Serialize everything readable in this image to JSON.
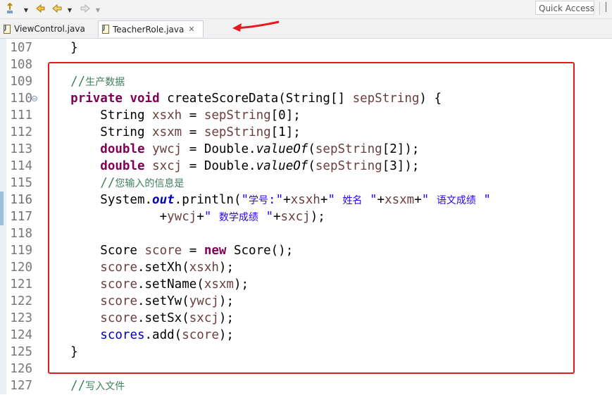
{
  "toolbar": {
    "quick_access_label": "Quick Access"
  },
  "tabs": [
    {
      "label": "ViewControl.java",
      "active": false
    },
    {
      "label": "TeacherRole.java",
      "active": true,
      "close": "✕"
    }
  ],
  "colors": {
    "keyword": "#7f0055",
    "string": "#2a00ff",
    "comment": "#3f7f5f",
    "field": "#0000c0",
    "local_variable": "#6a3e3e",
    "annotation_box": "#e8191e",
    "annotation_arrow": "#e8191e"
  },
  "editor": {
    "lines": [
      {
        "num": "107",
        "tokens": [
          {
            "t": "    }",
            "c": "plain"
          }
        ]
      },
      {
        "num": "108",
        "tokens": []
      },
      {
        "num": "109",
        "tokens": [
          {
            "t": "    //",
            "c": "cmt"
          },
          {
            "t": "生产数据",
            "c": "cmt cn"
          }
        ]
      },
      {
        "num": "110",
        "fold": true,
        "tokens": [
          {
            "t": "    ",
            "c": "plain"
          },
          {
            "t": "private",
            "c": "kw"
          },
          {
            "t": " ",
            "c": "plain"
          },
          {
            "t": "void",
            "c": "kw"
          },
          {
            "t": " createScoreData(String[] ",
            "c": "plain"
          },
          {
            "t": "sepString",
            "c": "var"
          },
          {
            "t": ") {",
            "c": "plain"
          }
        ]
      },
      {
        "num": "111",
        "tokens": [
          {
            "t": "        String ",
            "c": "plain"
          },
          {
            "t": "xsxh",
            "c": "var"
          },
          {
            "t": " = ",
            "c": "plain"
          },
          {
            "t": "sepString",
            "c": "var"
          },
          {
            "t": "[0];",
            "c": "plain"
          }
        ]
      },
      {
        "num": "112",
        "tokens": [
          {
            "t": "        String ",
            "c": "plain"
          },
          {
            "t": "xsxm",
            "c": "var"
          },
          {
            "t": " = ",
            "c": "plain"
          },
          {
            "t": "sepString",
            "c": "var"
          },
          {
            "t": "[1];",
            "c": "plain"
          }
        ]
      },
      {
        "num": "113",
        "tokens": [
          {
            "t": "        ",
            "c": "plain"
          },
          {
            "t": "double",
            "c": "kw"
          },
          {
            "t": " ",
            "c": "plain"
          },
          {
            "t": "ywcj",
            "c": "var"
          },
          {
            "t": " = Double.",
            "c": "plain"
          },
          {
            "t": "valueOf",
            "c": "mth-i"
          },
          {
            "t": "(",
            "c": "plain"
          },
          {
            "t": "sepString",
            "c": "var"
          },
          {
            "t": "[2]);",
            "c": "plain"
          }
        ]
      },
      {
        "num": "114",
        "tokens": [
          {
            "t": "        ",
            "c": "plain"
          },
          {
            "t": "double",
            "c": "kw"
          },
          {
            "t": " ",
            "c": "plain"
          },
          {
            "t": "sxcj",
            "c": "var"
          },
          {
            "t": " = Double.",
            "c": "plain"
          },
          {
            "t": "valueOf",
            "c": "mth-i"
          },
          {
            "t": "(",
            "c": "plain"
          },
          {
            "t": "sepString",
            "c": "var"
          },
          {
            "t": "[3]);",
            "c": "plain"
          }
        ]
      },
      {
        "num": "115",
        "tokens": [
          {
            "t": "        //",
            "c": "cmt"
          },
          {
            "t": "您输入的信息是",
            "c": "cmt cn"
          }
        ]
      },
      {
        "num": "116",
        "changed": true,
        "tokens": [
          {
            "t": "        System.",
            "c": "plain"
          },
          {
            "t": "out",
            "c": "sfld"
          },
          {
            "t": ".println(",
            "c": "plain"
          },
          {
            "t": "\"",
            "c": "str"
          },
          {
            "t": "学号",
            "c": "str cn"
          },
          {
            "t": ":\"",
            "c": "str"
          },
          {
            "t": "+",
            "c": "plain"
          },
          {
            "t": "xsxh",
            "c": "var"
          },
          {
            "t": "+",
            "c": "plain"
          },
          {
            "t": "\" ",
            "c": "str"
          },
          {
            "t": "姓名",
            "c": "str cn"
          },
          {
            "t": " \"",
            "c": "str"
          },
          {
            "t": "+",
            "c": "plain"
          },
          {
            "t": "xsxm",
            "c": "var"
          },
          {
            "t": "+",
            "c": "plain"
          },
          {
            "t": "\" ",
            "c": "str"
          },
          {
            "t": "语文成绩",
            "c": "str cn"
          },
          {
            "t": " \"",
            "c": "str"
          }
        ]
      },
      {
        "num": "117",
        "changed": true,
        "tokens": [
          {
            "t": "                ",
            "c": "plain"
          },
          {
            "t": "+",
            "c": "plain"
          },
          {
            "t": "ywcj",
            "c": "var"
          },
          {
            "t": "+",
            "c": "plain"
          },
          {
            "t": "\" ",
            "c": "str"
          },
          {
            "t": "数学成绩",
            "c": "str cn"
          },
          {
            "t": " \"",
            "c": "str"
          },
          {
            "t": "+",
            "c": "plain"
          },
          {
            "t": "sxcj",
            "c": "var"
          },
          {
            "t": ");",
            "c": "plain"
          }
        ]
      },
      {
        "num": "118",
        "tokens": []
      },
      {
        "num": "119",
        "tokens": [
          {
            "t": "        Score ",
            "c": "plain"
          },
          {
            "t": "score",
            "c": "var"
          },
          {
            "t": " = ",
            "c": "plain"
          },
          {
            "t": "new",
            "c": "kw"
          },
          {
            "t": " Score();",
            "c": "plain"
          }
        ]
      },
      {
        "num": "120",
        "tokens": [
          {
            "t": "        ",
            "c": "plain"
          },
          {
            "t": "score",
            "c": "var"
          },
          {
            "t": ".setXh(",
            "c": "plain"
          },
          {
            "t": "xsxh",
            "c": "var"
          },
          {
            "t": ");",
            "c": "plain"
          }
        ]
      },
      {
        "num": "121",
        "tokens": [
          {
            "t": "        ",
            "c": "plain"
          },
          {
            "t": "score",
            "c": "var"
          },
          {
            "t": ".setName(",
            "c": "plain"
          },
          {
            "t": "xsxm",
            "c": "var"
          },
          {
            "t": ");",
            "c": "plain"
          }
        ]
      },
      {
        "num": "122",
        "tokens": [
          {
            "t": "        ",
            "c": "plain"
          },
          {
            "t": "score",
            "c": "var"
          },
          {
            "t": ".setYw(",
            "c": "plain"
          },
          {
            "t": "ywcj",
            "c": "var"
          },
          {
            "t": ");",
            "c": "plain"
          }
        ]
      },
      {
        "num": "123",
        "tokens": [
          {
            "t": "        ",
            "c": "plain"
          },
          {
            "t": "score",
            "c": "var"
          },
          {
            "t": ".setSx(",
            "c": "plain"
          },
          {
            "t": "sxcj",
            "c": "var"
          },
          {
            "t": ");",
            "c": "plain"
          }
        ]
      },
      {
        "num": "124",
        "tokens": [
          {
            "t": "        ",
            "c": "plain"
          },
          {
            "t": "scores",
            "c": "fld"
          },
          {
            "t": ".add(",
            "c": "plain"
          },
          {
            "t": "score",
            "c": "var"
          },
          {
            "t": ");",
            "c": "plain"
          }
        ]
      },
      {
        "num": "125",
        "tokens": [
          {
            "t": "    }",
            "c": "plain"
          }
        ]
      },
      {
        "num": "126",
        "tokens": []
      },
      {
        "num": "127",
        "tokens": [
          {
            "t": "    //",
            "c": "cmt"
          },
          {
            "t": "写入文件",
            "c": "cmt cn"
          }
        ]
      }
    ]
  }
}
